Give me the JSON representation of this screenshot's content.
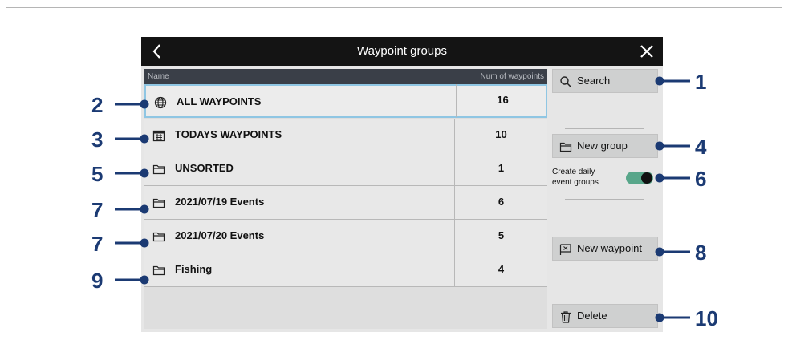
{
  "window": {
    "title": "Waypoint groups"
  },
  "table": {
    "header_name": "Name",
    "header_count": "Num of waypoints",
    "rows": [
      {
        "name": "ALL WAYPOINTS",
        "count": "16",
        "icon": "globe-icon"
      },
      {
        "name": "TODAYS WAYPOINTS",
        "count": "10",
        "icon": "calendar-icon"
      },
      {
        "name": "UNSORTED",
        "count": "1",
        "icon": "folder-icon"
      },
      {
        "name": "2021/07/19 Events",
        "count": "6",
        "icon": "folder-icon"
      },
      {
        "name": "2021/07/20 Events",
        "count": "5",
        "icon": "folder-icon"
      },
      {
        "name": "Fishing",
        "count": "4",
        "icon": "folder-icon"
      }
    ]
  },
  "side": {
    "search_label": "Search",
    "new_group_label": "New group",
    "toggle_label": "Create daily event groups",
    "toggle_on": true,
    "new_waypoint_label": "New waypoint",
    "delete_label": "Delete"
  },
  "callouts": [
    "1",
    "2",
    "3",
    "4",
    "5",
    "6",
    "7",
    "7",
    "8",
    "9",
    "10"
  ],
  "colors": {
    "callout": "#1b3a73",
    "titlebar": "#141414",
    "selected_border": "#8fc6e3",
    "toggle": "#58a68a"
  }
}
